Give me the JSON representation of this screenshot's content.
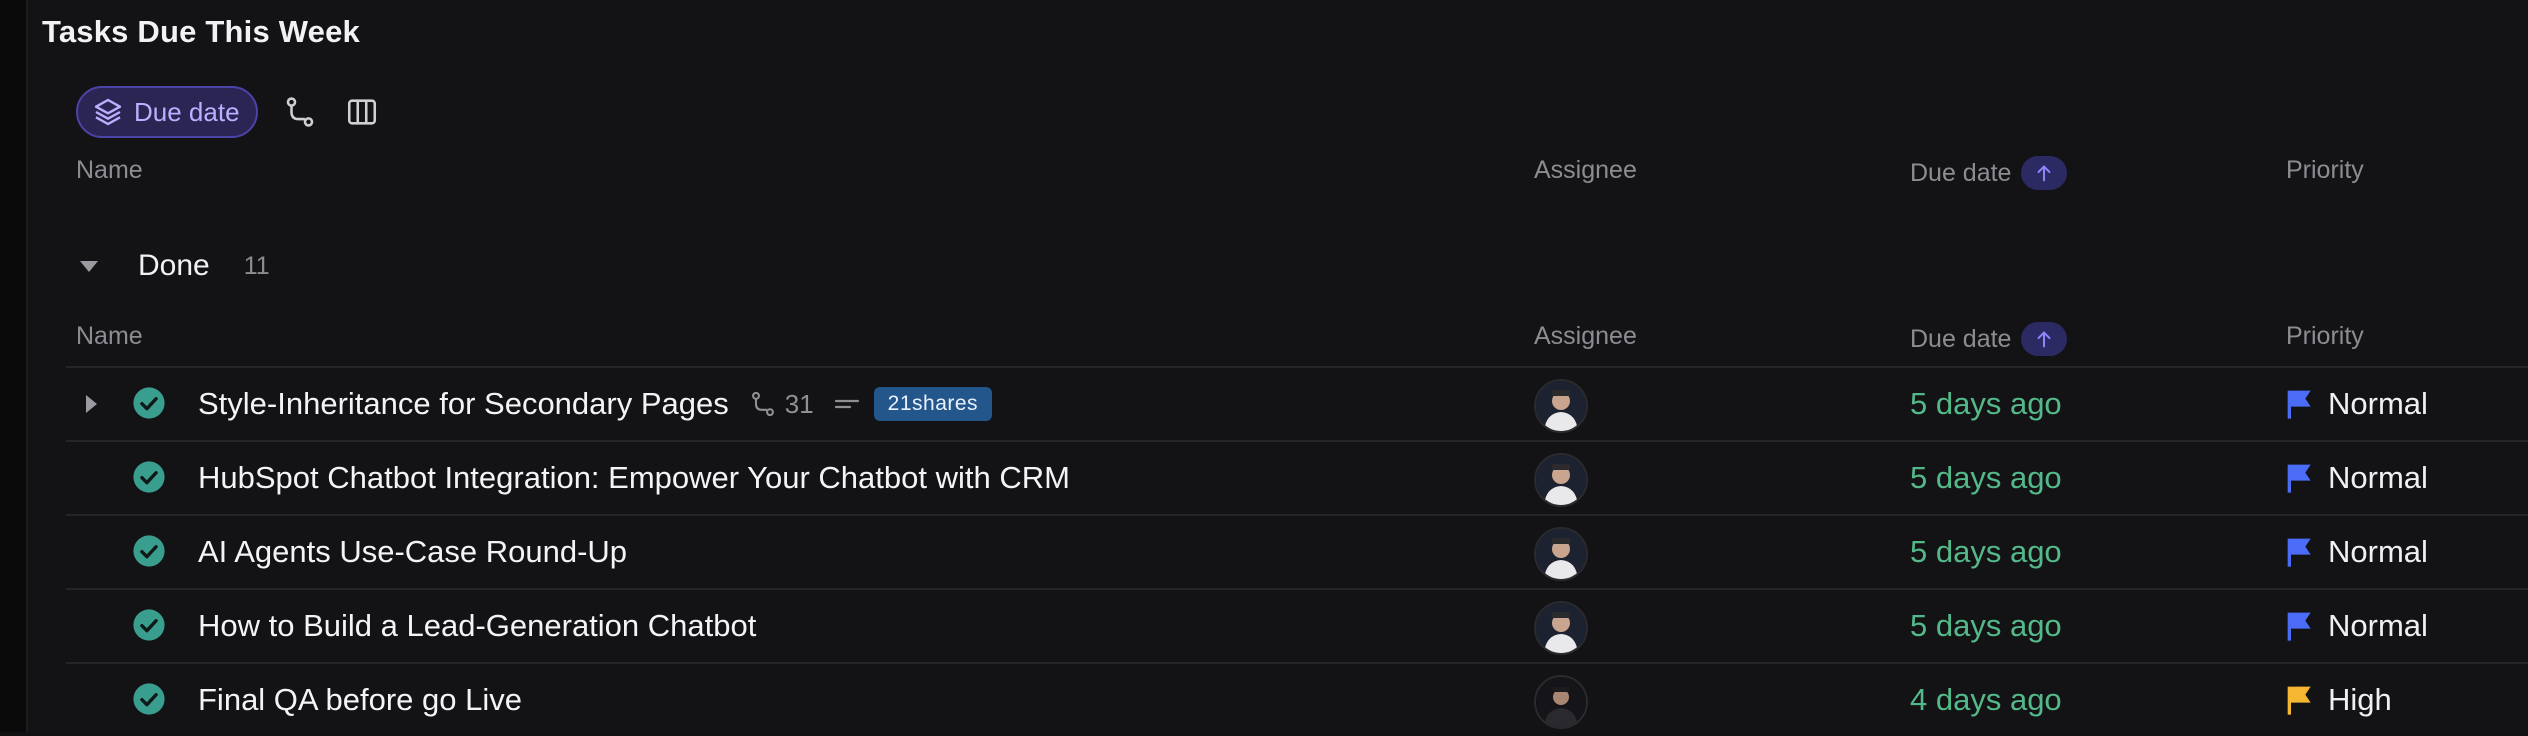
{
  "section": {
    "title": "Tasks Due This Week"
  },
  "toolbar": {
    "group_chip_label": "Due date",
    "group_chip_icon": "layers-icon",
    "subtasks_icon": "subtasks-icon",
    "columns_icon": "columns-icon"
  },
  "columns": {
    "name": "Name",
    "assignee": "Assignee",
    "due_date": "Due date",
    "priority": "Priority",
    "sort_icon": "arrow-up-icon"
  },
  "group": {
    "label": "Done",
    "count": "11"
  },
  "colors": {
    "accent": "#4c43a8",
    "done_check": "#3a9e8f",
    "due_text": "#54b98a",
    "flag_normal": "#4a6cf7",
    "flag_high": "#f5b731",
    "tag_bg": "#23568a"
  },
  "tasks": [
    {
      "name": "Style-Inheritance for Secondary Pages",
      "subtask_count": "31",
      "tag": "21shares",
      "due": "5 days ago",
      "priority": "Normal",
      "priority_level": "normal",
      "has_subtasks": true
    },
    {
      "name": "HubSpot Chatbot Integration: Empower Your Chatbot with CRM",
      "due": "5 days ago",
      "priority": "Normal",
      "priority_level": "normal"
    },
    {
      "name": "AI Agents Use-Case Round-Up",
      "due": "5 days ago",
      "priority": "Normal",
      "priority_level": "normal"
    },
    {
      "name": "How to Build a Lead-Generation Chatbot",
      "due": "5 days ago",
      "priority": "Normal",
      "priority_level": "normal"
    },
    {
      "name": "Final QA before go Live",
      "due": "4 days ago",
      "priority": "High",
      "priority_level": "high"
    }
  ]
}
